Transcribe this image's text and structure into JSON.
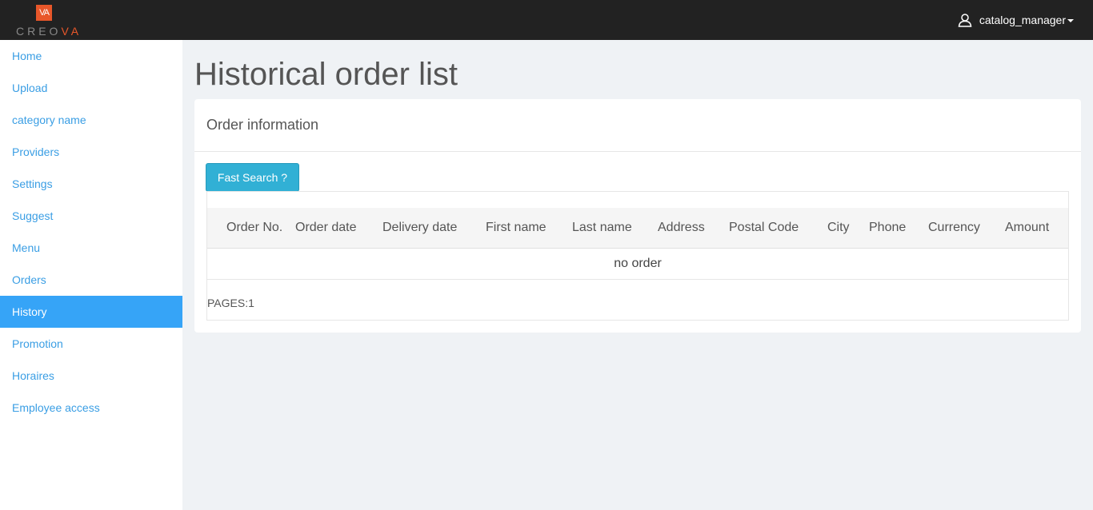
{
  "header": {
    "logo_mark": "VA",
    "logo_text_main": "CREO",
    "logo_text_accent": "VA",
    "user_name": "catalog_manager"
  },
  "sidebar": {
    "items": [
      {
        "label": "Home"
      },
      {
        "label": "Upload"
      },
      {
        "label": "category name"
      },
      {
        "label": "Providers"
      },
      {
        "label": "Settings"
      },
      {
        "label": "Suggest"
      },
      {
        "label": "Menu"
      },
      {
        "label": "Orders"
      },
      {
        "label": "History",
        "active": true
      },
      {
        "label": "Promotion"
      },
      {
        "label": "Horaires"
      },
      {
        "label": "Employee access"
      }
    ]
  },
  "main": {
    "title": "Historical order list",
    "panel_heading": "Order information",
    "search_button": "Fast Search ?",
    "columns": [
      "Order No.",
      "Order date",
      "Delivery date",
      "First name",
      "Last name",
      "Address",
      "Postal Code",
      "City",
      "Phone",
      "Currency",
      "Amount"
    ],
    "empty_message": "no order",
    "pages_label": "PAGES:1"
  },
  "colors": {
    "topbar": "#222222",
    "accent": "#e8572a",
    "link": "#3a9ee4",
    "active_nav": "#36a4f7",
    "button": "#31b0d5"
  }
}
